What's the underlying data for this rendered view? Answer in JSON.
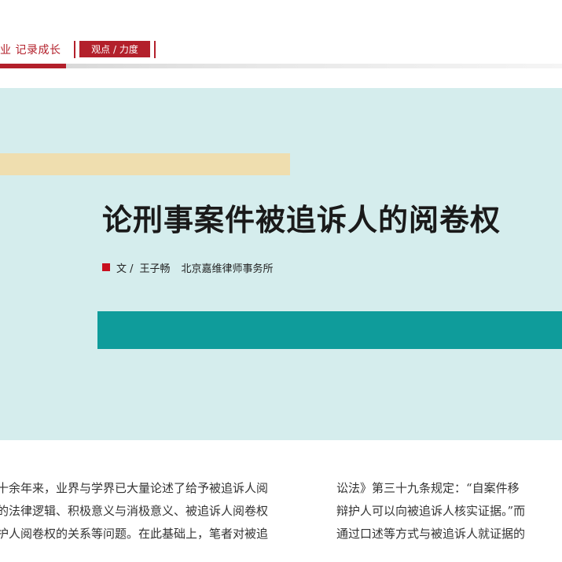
{
  "header": {
    "slogan": "业  记录成长",
    "section_tag": "观点 / 力度",
    "accent_color": "#b3202b"
  },
  "article": {
    "title": "论刑事案件被追诉人的阅卷权",
    "byline_prefix": "文 /",
    "author": "王子畅",
    "organization": "北京嘉维律师事务所"
  },
  "body": {
    "left_column": [
      "十余年来，业界与学界已大量论述了给予被追诉人阅",
      "的法律逻辑、积极意义与消极意义、被追诉人阅卷权",
      "护人阅卷权的关系等问题。在此基础上，笔者对被追",
      ""
    ],
    "right_column": [
      "讼法》第三十九条规定：“自案件移",
      "辩护人可以向被追诉人核实证据。”而",
      "通过口述等方式与被追诉人就证据的",
      ""
    ]
  },
  "colors": {
    "cover_background": "#d5eded",
    "teal": "#0f9c9b",
    "beige": "#efdeaf",
    "byline_square": "#c8101e"
  }
}
